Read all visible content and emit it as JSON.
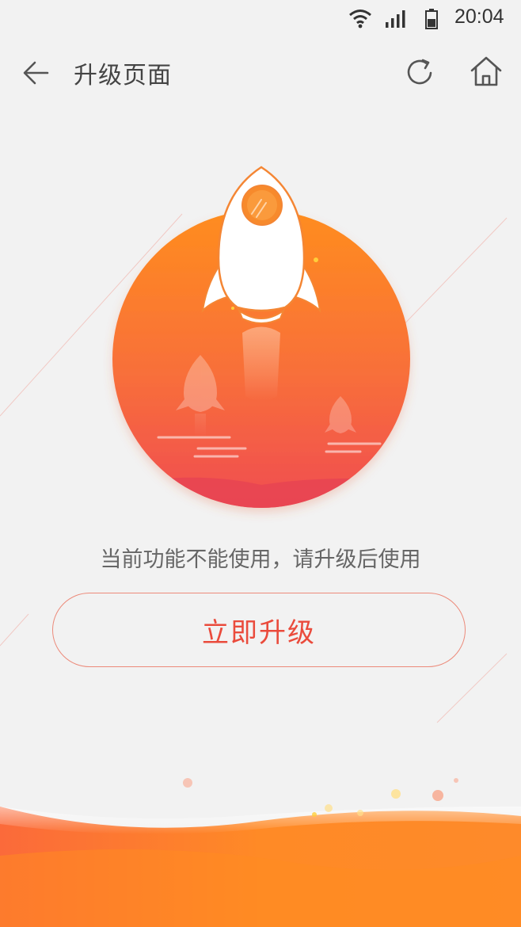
{
  "status_bar": {
    "time": "20:04",
    "icons": [
      "wifi-icon",
      "signal-icon",
      "battery-icon"
    ]
  },
  "nav": {
    "title": "升级页面",
    "icons": [
      "back-arrow-icon",
      "refresh-icon",
      "home-icon"
    ]
  },
  "main": {
    "illustration": "rocket-launch-illustration",
    "message": "当前功能不能使用，请升级后使用",
    "upgrade_button_label": "立即升级"
  },
  "colors": {
    "accent": "#ea4b3c",
    "orange_top": "#ff8d1e",
    "orange_bottom": "#f04c52",
    "background": "#f2f2f2"
  }
}
